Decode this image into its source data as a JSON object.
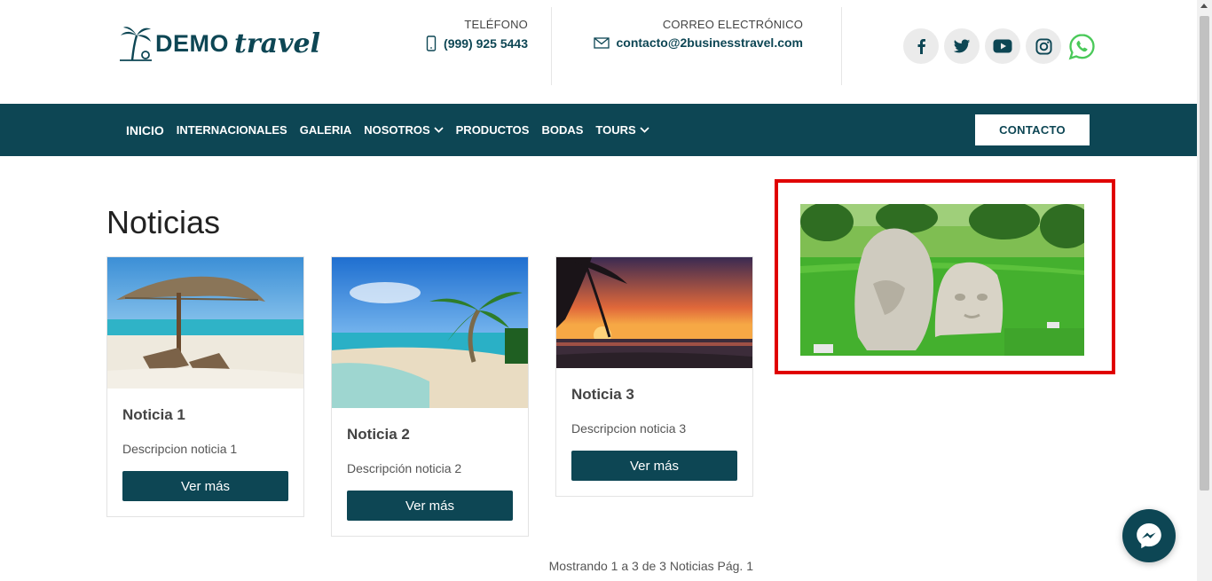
{
  "brand": {
    "name_block": "DEMO",
    "name_script": "travel"
  },
  "header": {
    "phone_label": "TELÉFONO",
    "phone_value": "(999) 925 5443",
    "email_label": "CORREO ELECTRÓNICO",
    "email_value": "contacto@2businesstravel.com"
  },
  "socials": [
    "facebook-icon",
    "twitter-icon",
    "youtube-icon",
    "instagram-icon",
    "whatsapp-icon"
  ],
  "nav": {
    "items": [
      {
        "label": "INICIO"
      },
      {
        "label": "INTERNACIONALES"
      },
      {
        "label": "GALERIA"
      },
      {
        "label": "NOSOTROS",
        "dropdown": true
      },
      {
        "label": "PRODUCTOS"
      },
      {
        "label": "BODAS"
      },
      {
        "label": "TOURS",
        "dropdown": true
      }
    ],
    "contact_button": "CONTACTO"
  },
  "page": {
    "title": "Noticias",
    "results_text": "Mostrando 1 a 3 de 3 Noticias Pág. 1"
  },
  "news": [
    {
      "title": "Noticia 1",
      "description": "Descripcion noticia 1",
      "button": "Ver más"
    },
    {
      "title": "Noticia 2",
      "description": "Descripción noticia 2",
      "button": "Ver más"
    },
    {
      "title": "Noticia 3",
      "description": "Descripcion noticia 3",
      "button": "Ver más"
    }
  ],
  "colors": {
    "primary": "#0d4654",
    "highlight": "#e00000",
    "whatsapp": "#4ac959"
  }
}
